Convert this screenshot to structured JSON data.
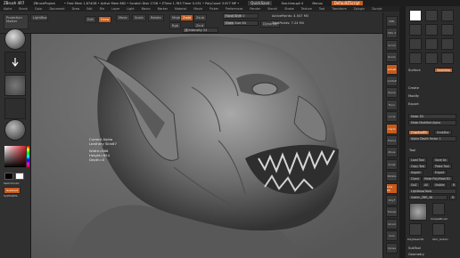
{
  "titlebar": {
    "app": "ZBrush 4R7",
    "project": "ZBrushProject",
    "mem": "• Free Mem 1.874GB • Active Mem 882 • Scratch Disk 1728 • ZTime 1.783 Timer 0.031 • PolyCount 3.677 MP •",
    "quicksave": "QuickSave",
    "seethrough": "See-through 0",
    "menus": "Menus",
    "default_script": "DefaultZScript"
  },
  "menubar": [
    "Alpha",
    "Brush",
    "Color",
    "Document",
    "Draw",
    "Edit",
    "File",
    "Layer",
    "Light",
    "Macro",
    "Marker",
    "Material",
    "Movie",
    "Picker",
    "Preferences",
    "Render",
    "Stencil",
    "Stroke",
    "Texture",
    "Tool",
    "Transform",
    "Zplugin",
    "Zscript"
  ],
  "shelf": {
    "projection_master": "Projection Master",
    "lightbox": "LightBox",
    "edit": "Edit",
    "draw": "Draw",
    "move": "Move",
    "scale": "Scale",
    "rotate": "Rotate",
    "mrgb": "Mrgb",
    "rgb": "Rgb",
    "m": "M",
    "zadd": "Zadd",
    "zsub": "Zsub",
    "zcut": "Zcut",
    "focal_shift": "Focal Shift 0",
    "draw_size": "Draw Size 64",
    "z_intensity": "Z Intensity 12",
    "active_points": "ActivePoints: 4.547 Mil",
    "total_points": "TotalPoints: 7.24 Mil",
    "dynamic": "Dynamic"
  },
  "alpha_tip": {
    "line1": "Current Alpha",
    "line2": "Leathery Skin67",
    "line3": "Width=868",
    "line4": "Height=654",
    "line5": "Depth=0"
  },
  "left": {
    "switch_color": "SwitchColor",
    "gradient": "Gradient",
    "alternate": "Alternate",
    "sysp_palette": "SysPalette"
  },
  "right_shelf": [
    "BPR",
    "SPix 3",
    "Scroll",
    "Zoom",
    "Actual",
    "AAHalf",
    "Persp",
    "Floor",
    "Local",
    "LSym",
    "Frame",
    "Move",
    "Scale",
    "Rotate",
    "Line Fill",
    "PolyF",
    "Transp",
    "Ghost",
    "Solo",
    "Xpose"
  ],
  "panel": {
    "surface": "Surface",
    "seamless": "Seamless",
    "create": "Create",
    "modify": "Modify",
    "export": "Export",
    "make_3d": "Make 3D",
    "make_modified_alpha": "Make Modified Alpha",
    "crop_and_fill": "CropAndFill",
    "grab_doc": "GrabDoc",
    "alpha_depth_factor": "Alpha Depth Factor 1",
    "tool": "Tool",
    "load_tool": "Load Tool",
    "save_as": "Save As",
    "copy_tool": "Copy Tool",
    "paste_tool": "Paste Tool",
    "import": "Import",
    "export_tool": "Export",
    "clone": "Clone",
    "make_polymesh": "Make PolyMesh3D",
    "goz": "GoZ",
    "all": "All",
    "visible": "Visible",
    "r": "R",
    "lightbox_tools": "Lightbox▸Tools",
    "tool_name": "Goblin_ZBR_48",
    "fill_label": "R",
    "simple_brush": "SimpleBrush",
    "polymesh": "PolyMesh3D",
    "skin": "Skin_Goblin",
    "subtool": "SubTool",
    "geometry": "Geometry"
  },
  "colors": {
    "accent": "#c85a1c",
    "canvas": "#6c6c6c",
    "ui_bg": "#2b2b2b"
  }
}
